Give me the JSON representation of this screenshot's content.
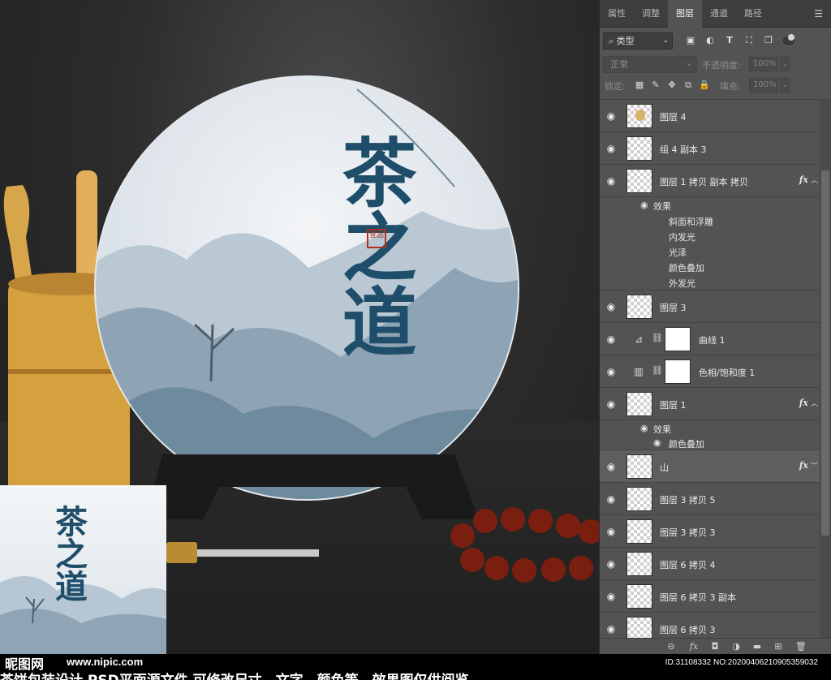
{
  "panel": {
    "tabs": [
      "属性",
      "调整",
      "图层",
      "通道",
      "路径"
    ],
    "active_tab": "图层",
    "filter_label": "类型",
    "blend_mode": "正常",
    "opacity_label": "不透明度:",
    "opacity_value": "100%",
    "lock_label": "锁定:",
    "fill_label": "填充:",
    "fill_value": "100%",
    "effects_label": "效果",
    "layers": [
      {
        "name": "图层 4"
      },
      {
        "name": "组 4 副本 3"
      },
      {
        "name": "图层 1 拷贝 副本 拷贝",
        "fx": "fx",
        "effects": [
          "斜面和浮雕",
          "内发光",
          "光泽",
          "颜色叠加",
          "外发光"
        ]
      },
      {
        "name": "图层 3"
      },
      {
        "name": "曲线 1"
      },
      {
        "name": "色相/饱和度 1"
      },
      {
        "name": "图层 1",
        "fx": "fx",
        "effects": [
          "颜色叠加"
        ]
      },
      {
        "name": "山",
        "fx": "fx"
      },
      {
        "name": "图层 3 拷贝 5"
      },
      {
        "name": "图层 3 拷贝 3"
      },
      {
        "name": "图层 6 拷贝 4"
      },
      {
        "name": "图层 6 拷贝 3 副本"
      },
      {
        "name": "图层 6 拷贝 3"
      }
    ]
  },
  "artwork": {
    "calligraphy": "茶之道",
    "seal": "壹品"
  },
  "watermark": {
    "logo": "昵图网",
    "url": "www.nipic.com",
    "id_line": "ID:31108332 NO:20200406210905359032",
    "caption": "茶饼包装设计 PSD平面源文件 可修改尺寸、文字、颜色等，效果图仅供阅览"
  }
}
